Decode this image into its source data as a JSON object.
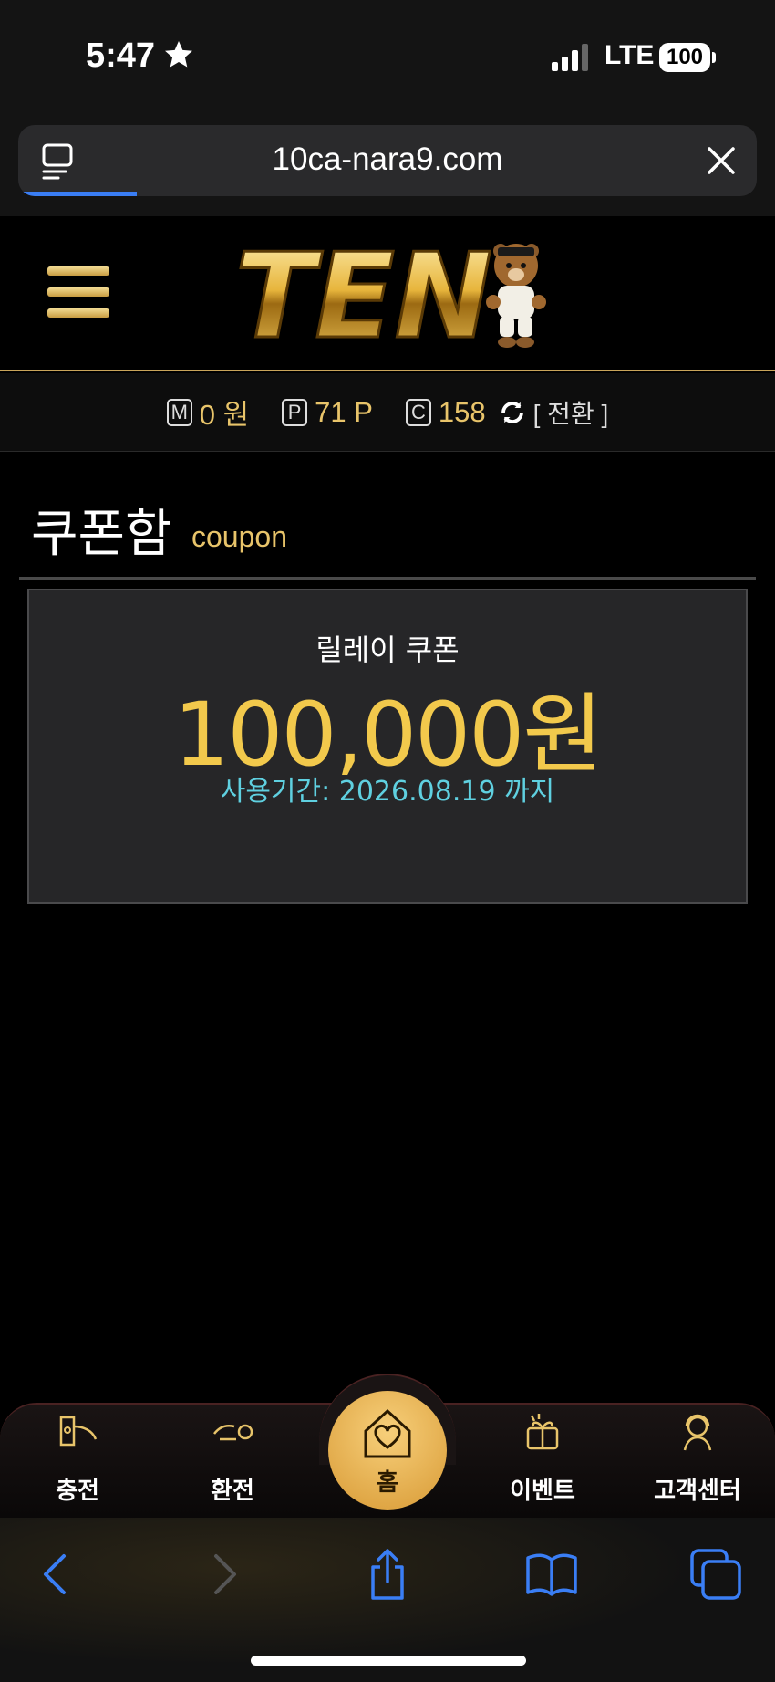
{
  "status_bar": {
    "time": "5:47",
    "network": "LTE",
    "battery": "100"
  },
  "browser": {
    "url": "10ca-nara9.com",
    "load_progress": 0.16
  },
  "site": {
    "logo_text": "TEN"
  },
  "balances": {
    "money_icon": "M",
    "money": "0 원",
    "point_icon": "P",
    "points": "71 P",
    "coin_icon": "C",
    "coins": "158",
    "switch_label": "[ 전환 ]"
  },
  "page": {
    "title": "쿠폰함",
    "subtitle": "coupon"
  },
  "coupon": {
    "name": "릴레이 쿠폰",
    "amount": "100,000원",
    "period": "사용기간: 2026.08.19 까지"
  },
  "bottom_nav": {
    "charge": "충전",
    "exchange": "환전",
    "home": "홈",
    "event": "이벤트",
    "support": "고객센터"
  },
  "colors": {
    "gold": "#e8c46a",
    "amount": "#f2c94c",
    "period": "#5fd0e0",
    "safari_blue": "#3a7ef5"
  }
}
